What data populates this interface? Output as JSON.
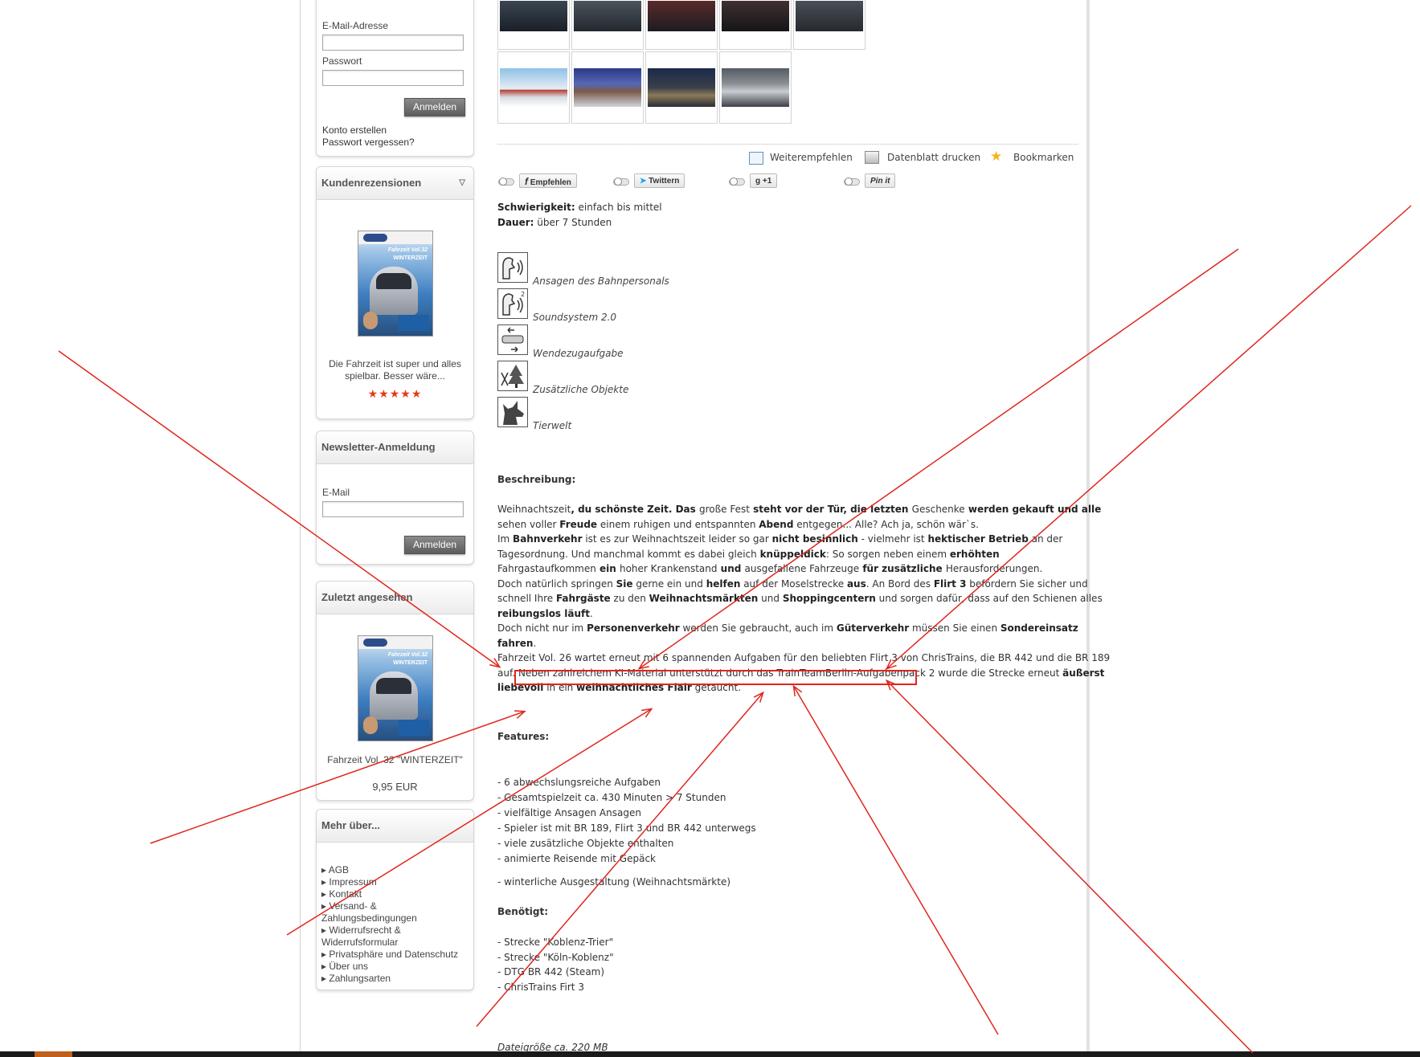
{
  "login": {
    "email_label": "E-Mail-Adresse",
    "password_label": "Passwort",
    "login_button": "Anmelden",
    "create_account": "Konto erstellen",
    "forgot_password": "Passwort vergessen?"
  },
  "reviews": {
    "title": "Kundenrezensionen",
    "review_text_1": "Die Fahrzeit ist super und alles",
    "review_text_2": "spielbar. Besser wäre...",
    "stars": "★★★★★",
    "cover_title": "Fahrzeit Vol.32",
    "cover_subtitle": "WINTERZEIT"
  },
  "newsletter": {
    "title": "Newsletter-Anmeldung",
    "email_label": "E-Mail",
    "button": "Anmelden"
  },
  "recent": {
    "title": "Zuletzt angesehen",
    "product_name": "Fahrzeit Vol. 32 \"WINTERZEIT\"",
    "price": "9,95 EUR",
    "cover_title": "Fahrzeit Vol.32",
    "cover_subtitle": "WINTERZEIT"
  },
  "more": {
    "title": "Mehr über...",
    "links": [
      "AGB",
      "Impressum",
      "Kontakt",
      "Versand- &",
      "Zahlungsbedingungen",
      "Widerrufsrecht &",
      "Widerrufsformular",
      "Privatsphäre und Datenschutz",
      "Über uns",
      "Zahlungsarten"
    ]
  },
  "actions": {
    "recommend": "Weiterempfehlen",
    "print": "Datenblatt drucken",
    "bookmark": "Bookmarken"
  },
  "social": {
    "facebook": "Empfehlen",
    "twitter": "Twittern",
    "gplus": "+1",
    "pinterest": "Pin it"
  },
  "meta": {
    "difficulty_label": "Schwierigkeit:",
    "difficulty_value": "einfach bis mittel",
    "duration_label": "Dauer:",
    "duration_value": "über 7 Stunden"
  },
  "feature_icons": [
    {
      "label": "Ansagen des Bahnpersonals",
      "icon": "speaker-person-icon"
    },
    {
      "label": "Soundsystem 2.0",
      "icon": "sound-system-icon"
    },
    {
      "label": "Wendezugaufgabe",
      "icon": "push-pull-train-icon"
    },
    {
      "label": "Zusätzliche Objekte",
      "icon": "objects-icon"
    },
    {
      "label": "Tierwelt",
      "icon": "animal-icon"
    }
  ],
  "description": {
    "heading": "Beschreibung:",
    "paragraph_lines": [
      [
        "Weihnachtszeit",
        ", du schönste Zeit. Das ",
        "große Fest",
        " steht vor der Tür, die letzten ",
        "Geschenke",
        " werden gekauft und alle"
      ],
      [
        "sehen voller ",
        "Freude",
        " einem ruhigen und entspannten ",
        "Abend",
        " entgegen... Alle? Ach ja, schön wär`s."
      ],
      [
        "Im ",
        "Bahnverkehr",
        " ist es zur Weihnachtszeit leider so gar ",
        "nicht besinnlich",
        " - vielmehr ist ",
        "hektischer Betrieb",
        " an der"
      ],
      [
        "Tagesordnung. Und manchmal kommt es dabei gleich ",
        "knüppeldick",
        ": So sorgen neben einem ",
        "erhöhten"
      ],
      [
        "Fahrgastaufkommen",
        " ein ",
        "hoher Krankenstand",
        " und ",
        "ausgefallene Fahrzeuge",
        " für zusätzliche ",
        "Herausforderungen."
      ],
      [
        "Doch natürlich springen ",
        "Sie",
        " gerne ein und ",
        "helfen",
        " auf der Moselstrecke ",
        "aus",
        ". An Bord des ",
        "Flirt 3",
        " befördern Sie sicher und"
      ],
      [
        "schnell Ihre ",
        "Fahrgäste",
        " zu den ",
        "Weihnachtsmärkten",
        " und ",
        "Shoppingcentern",
        " und sorgen dafür, dass auf den Schienen alles"
      ],
      [
        "",
        "reibungslos läuft",
        "."
      ],
      [
        "Doch nicht nur im ",
        "Personenverkehr",
        " werden Sie gebraucht, auch im ",
        "Güterverkehr",
        " müssen Sie einen ",
        "Sondereinsatz"
      ],
      [
        "",
        "fahren",
        "."
      ],
      [
        "Fahrzeit Vol. 26 wartet erneut mit 6 spannenden Aufgaben für den beliebten Flirt 3 von ChrisTrains, die BR 442 und die BR 189"
      ],
      [
        "auf. Neben zahlreichem KI-Material unterstützt durch das TrainTeamBerlin-Aufgabenpack 2 wurde die Strecke erneut ",
        "äußerst"
      ],
      [
        "",
        "liebevoll",
        " in ein ",
        "weihnachtliches Flair",
        " getaucht."
      ]
    ]
  },
  "features": {
    "heading": "Features:",
    "items": [
      "- 6 abwechslungsreiche Aufgaben",
      "- Gesamtspielzeit ca. 430 Minuten > 7 Stunden",
      "- vielfältige Ansagen Ansagen",
      "- Spieler ist mit BR 189, Flirt 3 und BR 442 unterwegs",
      "- viele zusätzliche Objekte enthalten",
      "- animierte Reisende mit Gepäck"
    ],
    "extra": "- winterliche Ausgestaltung (Weihnachtsmärkte)"
  },
  "required": {
    "heading": "Benötigt:",
    "items": [
      "- Strecke \"Koblenz-Trier\"",
      "- Strecke \"Köln-Koblenz\"",
      "- DTG BR 442 (Steam)",
      "- ChrisTrains Firt 3"
    ]
  },
  "filesize": "Dateigröße ca. 220 MB",
  "colors": {
    "annotation": "#e0261d",
    "stars": "#e8391d",
    "accent": "#c0601f"
  }
}
